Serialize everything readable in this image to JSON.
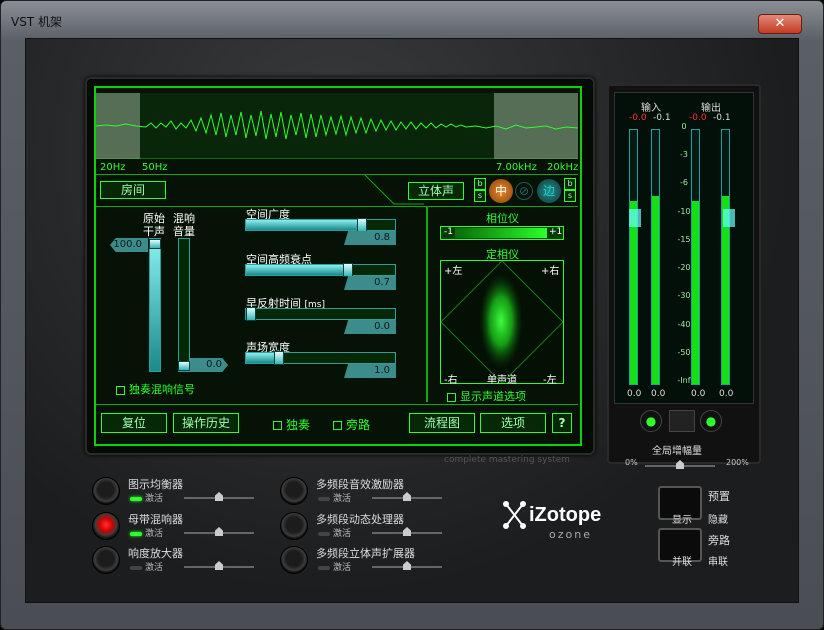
{
  "window": {
    "title": "VST 机架",
    "close_glyph": "✕"
  },
  "spectrum": {
    "labels": [
      "20Hz",
      "50Hz",
      "7.00kHz",
      "20kHz"
    ]
  },
  "room": {
    "button": "房间",
    "stereo_button": "立体声",
    "band_b": "b",
    "band_s": "s",
    "band_mid": "中",
    "band_side": "边",
    "mode_circle": "⊘"
  },
  "sliders": {
    "dry_label1": "原始",
    "dry_label2": "干声",
    "wet_label1": "混响",
    "wet_label2": "音量",
    "dry_value": "100.0",
    "wet_value": "0.0",
    "dry_level": 1.0,
    "wet_level": 0.0,
    "items": [
      {
        "label": "空间广度",
        "value": "0.8",
        "level": 0.8
      },
      {
        "label": "空间高频衰点",
        "value": "0.7",
        "level": 0.7
      },
      {
        "label": "早反射时间",
        "unit": "[ms]",
        "value": "0.0",
        "level": 0.0
      },
      {
        "label": "声场宽度",
        "value": "1.0",
        "level": 0.2
      }
    ],
    "solo_reverb": "独奏混响信号"
  },
  "phase": {
    "title": "相位仪",
    "minus": "-1",
    "plus": "+1",
    "level": 0.85
  },
  "vector": {
    "title": "定相仪",
    "tl": "+左",
    "tr": "+右",
    "bl": "-右",
    "bc": "单声道",
    "br": "-左",
    "mono_option": "显示声道选项"
  },
  "bottom_buttons": {
    "reset": "复位",
    "history": "操作历史",
    "solo": "独奏",
    "bypass": "旁路",
    "graph": "流程图",
    "options": "选项",
    "help": "?"
  },
  "brand_strip": "complete mastering system",
  "meters": {
    "in_label": "输入",
    "out_label": "输出",
    "in_peak_l": "-0.0",
    "in_peak_r": "-0.1",
    "out_peak_l": "-0.0",
    "out_peak_r": "-0.1",
    "scale": [
      "0",
      "-3",
      "-6",
      "-10",
      "-15",
      "-20",
      "-30",
      "-40",
      "-50",
      "-Inf"
    ],
    "bottom": [
      "0.0",
      "0.0",
      "0.0",
      "0.0"
    ],
    "in_fill": [
      0.72,
      0.74
    ],
    "out_fill": [
      0.72,
      0.74
    ],
    "global_gain": "全局增幅量",
    "gain_min": "0%",
    "gain_max": "200%"
  },
  "modules": [
    {
      "name": "图示均衡器",
      "active": "激活",
      "on": true,
      "power": false
    },
    {
      "name": "母带混响器",
      "active": "激活",
      "on": true,
      "power": true
    },
    {
      "name": "响度放大器",
      "active": "激活",
      "on": false,
      "power": false
    },
    {
      "name": "多频段音效激励器",
      "active": "激活",
      "on": false,
      "power": false
    },
    {
      "name": "多频段动态处理器",
      "active": "激活",
      "on": false,
      "power": false
    },
    {
      "name": "多频段立体声扩展器",
      "active": "激活",
      "on": false,
      "power": false
    }
  ],
  "logo": {
    "line1": "iZotope",
    "line2": "ozone"
  },
  "right_controls": {
    "preset": "预置",
    "show": "显示",
    "hide": "隐藏",
    "bypass": "旁路",
    "parallel": "并联",
    "serial": "串联"
  },
  "colors": {
    "green": "#2cff2c",
    "cyan": "#2aa0a0",
    "meter": "#14e014"
  }
}
